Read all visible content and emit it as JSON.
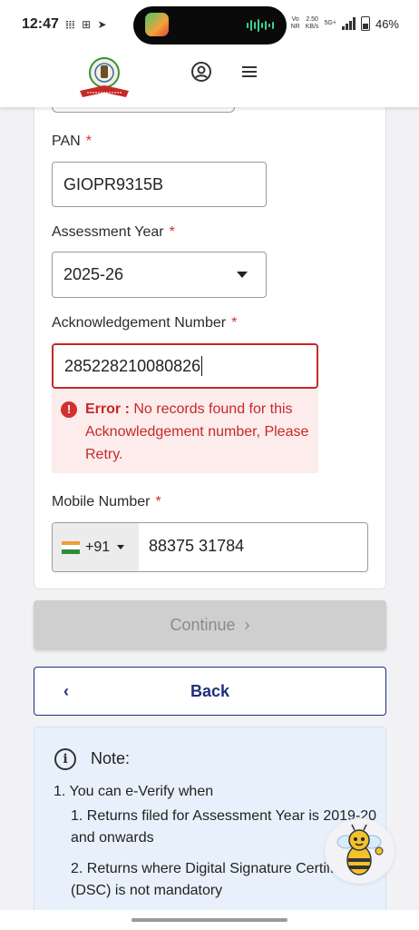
{
  "status_bar": {
    "time": "12:47",
    "left_icons": "𝍖 ⊞ ➤",
    "volte": [
      "Vo",
      "NR"
    ],
    "speed": [
      "2.50",
      "KB/s"
    ],
    "network": "5G+",
    "battery": "46%"
  },
  "header": {
    "logo_icon": "income-tax-emblem",
    "user_icon": "user-circle-icon",
    "menu_icon": "hamburger-menu-icon"
  },
  "form": {
    "pan": {
      "label": "PAN",
      "required": "*",
      "value": "GIOPR9315B"
    },
    "assessment_year": {
      "label": "Assessment Year",
      "required": "*",
      "value": "2025-26"
    },
    "ack_number": {
      "label": "Acknowledgement Number",
      "required": "*",
      "value": "285228210080826"
    },
    "error": {
      "prefix": "Error :",
      "message": "No records found for this Acknowledgement number, Please Retry."
    },
    "mobile": {
      "label": "Mobile Number",
      "required": "*",
      "country_code": "+91",
      "value": "88375 31784"
    }
  },
  "buttons": {
    "continue": "Continue",
    "continue_chevron": "›",
    "back": "Back",
    "back_chevron": "‹"
  },
  "note": {
    "title": "Note:",
    "line1": "1. You can e-Verify when",
    "line2": "1. Returns filed for Assessment Year is 2019-20 and onwards",
    "line3": "2. Returns where Digital Signature Certificate (DSC) is not mandatory"
  },
  "colors": {
    "error": "#c62828",
    "primary": "#1f2f7a",
    "note_bg": "#e8f1fb"
  }
}
